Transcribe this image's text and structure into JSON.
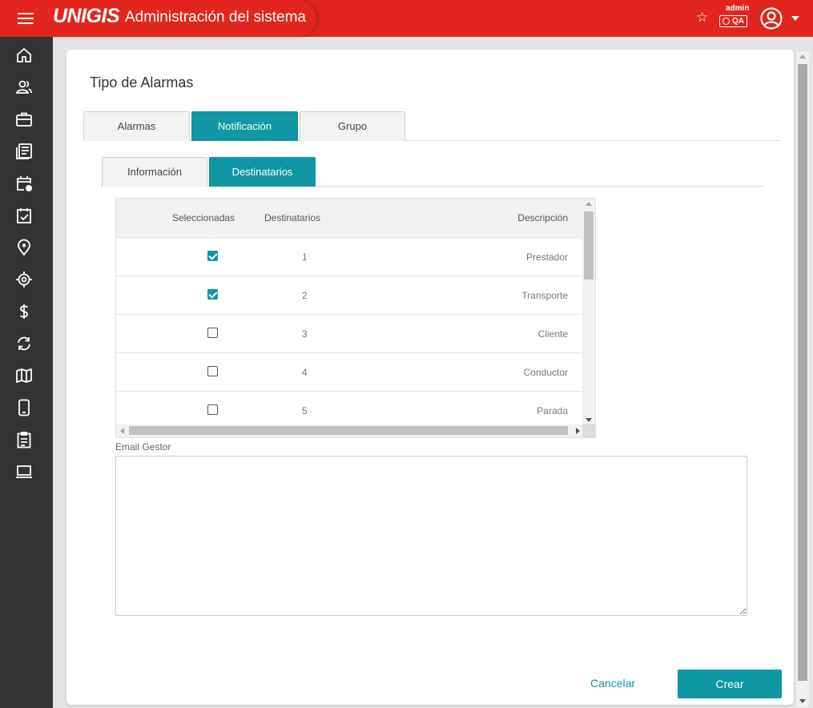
{
  "header": {
    "logo": "UNIGIS",
    "app_title": "Administración del sistema",
    "user": "admin",
    "environment": "QA"
  },
  "sidebar": {
    "items": [
      {
        "name": "home-icon"
      },
      {
        "name": "users-icon"
      },
      {
        "name": "briefcase-icon"
      },
      {
        "name": "news-icon"
      },
      {
        "name": "calendar-clock-icon"
      },
      {
        "name": "calendar-check-icon"
      },
      {
        "name": "location-pin-icon"
      },
      {
        "name": "target-icon"
      },
      {
        "name": "dollar-icon"
      },
      {
        "name": "sync-icon"
      },
      {
        "name": "map-icon"
      },
      {
        "name": "mobile-icon"
      },
      {
        "name": "clipboard-icon"
      },
      {
        "name": "laptop-icon"
      }
    ]
  },
  "page": {
    "title": "Tipo de Alarmas"
  },
  "tabs": [
    {
      "label": "Alarmas",
      "active": false
    },
    {
      "label": "Notificación",
      "active": true
    },
    {
      "label": "Grupo",
      "active": false
    }
  ],
  "subtabs": [
    {
      "label": "Información",
      "active": false
    },
    {
      "label": "Destinatarios",
      "active": true
    }
  ],
  "grid": {
    "columns": {
      "selected": "Seleccionadas",
      "recipients": "Destinatarios",
      "description": "Descripción"
    },
    "rows": [
      {
        "checked": true,
        "num": "1",
        "desc": "Prestador"
      },
      {
        "checked": true,
        "num": "2",
        "desc": "Transporte"
      },
      {
        "checked": false,
        "num": "3",
        "desc": "Cliente"
      },
      {
        "checked": false,
        "num": "4",
        "desc": "Conductor"
      },
      {
        "checked": false,
        "num": "5",
        "desc": "Parada"
      }
    ]
  },
  "email": {
    "label": "Email Gestor",
    "value": ""
  },
  "actions": {
    "cancel": "Cancelar",
    "create": "Crear"
  },
  "colors": {
    "brand_red": "#e2261d",
    "accent_teal": "#0f97a3",
    "sidebar": "#333333"
  }
}
